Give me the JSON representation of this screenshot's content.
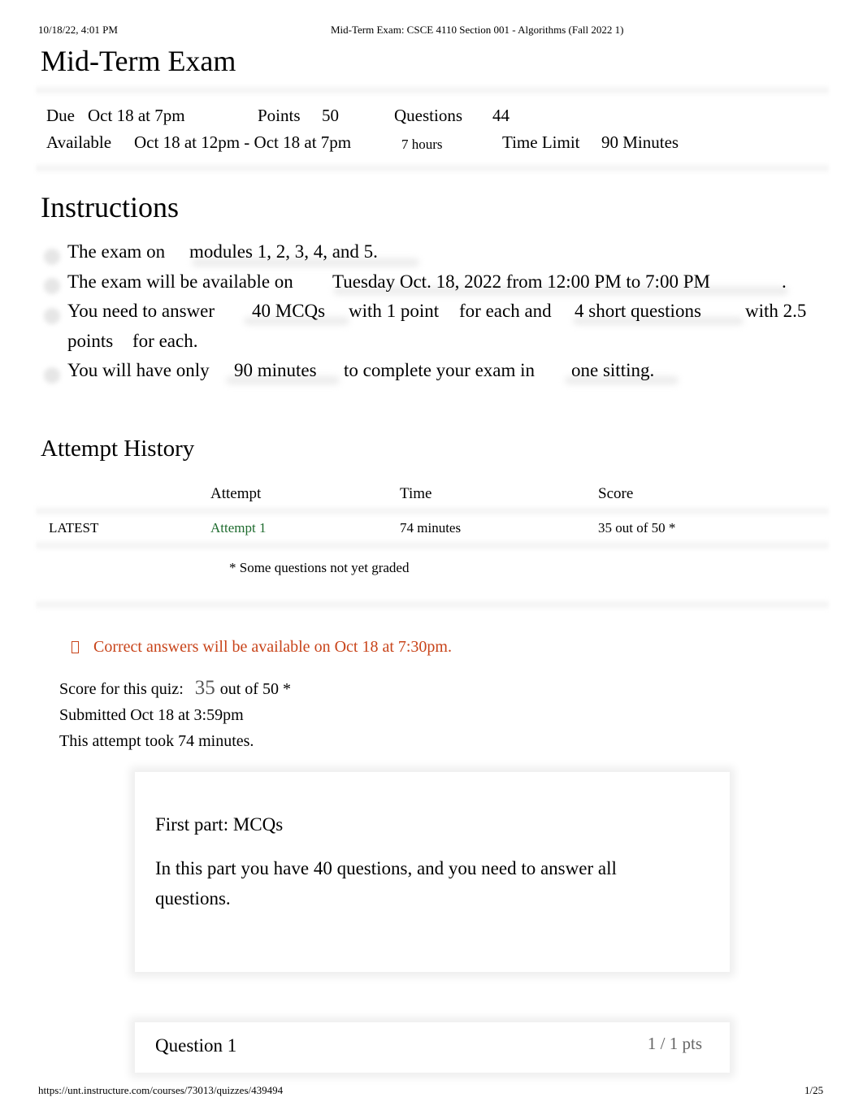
{
  "print_header": {
    "datetime": "10/18/22, 4:01 PM",
    "page_title": "Mid-Term Exam: CSCE 4110 Section 001 - Algorithms (Fall 2022 1)"
  },
  "quiz": {
    "title": "Mid-Term Exam",
    "meta": {
      "due_label": "Due",
      "due_value": "Oct 18 at 7pm",
      "points_label": "Points",
      "points_value": "50",
      "questions_label": "Questions",
      "questions_value": "44",
      "available_label": "Available",
      "available_value": "Oct 18 at 12pm - Oct 18 at 7pm",
      "available_duration": "7 hours",
      "time_limit_label": "Time Limit",
      "time_limit_value": "90 Minutes"
    }
  },
  "instructions": {
    "heading": "Instructions",
    "items": [
      {
        "parts": [
          "The exam on",
          "modules 1, 2, 3, 4, and 5."
        ]
      },
      {
        "parts": [
          "The exam will be available on",
          "Tuesday Oct. 18, 2022 from 12:00 PM to 7:00 PM",
          "."
        ]
      },
      {
        "parts": [
          "You need to answer",
          "40 MCQs",
          "with 1 point",
          "for each and",
          "4 short questions",
          "with 2.5",
          "points",
          "for each."
        ]
      },
      {
        "parts": [
          "You will have only",
          "90 minutes",
          "to complete your exam in",
          "one sitting."
        ]
      }
    ]
  },
  "attempt_history": {
    "heading": "Attempt History",
    "columns": [
      "",
      "Attempt",
      "Time",
      "Score"
    ],
    "rows": [
      {
        "tag": "LATEST",
        "attempt": "Attempt 1",
        "time": "74 minutes",
        "score": "35 out of 50 *"
      }
    ],
    "note": "* Some questions not yet graded"
  },
  "result": {
    "warning_icon": "warning-icon",
    "warning": "Correct answers will be available on Oct 18 at 7:30pm.",
    "score_label": "Score for this quiz:",
    "score_value": "35",
    "score_total": "out of 50 *",
    "submitted": "Submitted Oct 18 at 3:59pm",
    "duration": "This attempt took 74 minutes.",
    "colors": {
      "warning": "#c8441a",
      "link": "#1e6b2e"
    }
  },
  "part_card": {
    "title": "First part:  MCQs",
    "body": "In this part you have 40 questions, and you need to answer all questions."
  },
  "question": {
    "title": "Question 1",
    "points": "1 / 1 pts"
  },
  "print_footer": {
    "url": "https://unt.instructure.com/courses/73013/quizzes/439494",
    "page": "1/25"
  }
}
